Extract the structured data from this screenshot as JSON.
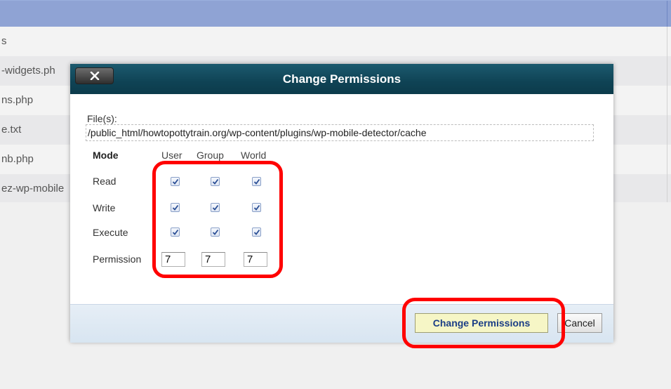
{
  "background": {
    "files": [
      "s",
      "-widgets.ph",
      "ns.php",
      "e.txt",
      "nb.php",
      "ez-wp-mobile"
    ]
  },
  "dialog": {
    "title": "Change Permissions",
    "close_icon": "close-icon",
    "files_label": "File(s):",
    "path": "/public_html/howtopottytrain.org/wp-content/plugins/wp-mobile-detector/cache",
    "columns": [
      "Mode",
      "User",
      "Group",
      "World"
    ],
    "rows": [
      {
        "label": "Read",
        "user": true,
        "group": true,
        "world": true
      },
      {
        "label": "Write",
        "user": true,
        "group": true,
        "world": true
      },
      {
        "label": "Execute",
        "user": true,
        "group": true,
        "world": true
      }
    ],
    "permission_label": "Permission",
    "permission_values": {
      "user": "7",
      "group": "7",
      "world": "7"
    },
    "buttons": {
      "change": "Change Permissions",
      "cancel": "Cancel"
    }
  },
  "colors": {
    "titlebar": "#0f4355",
    "header_band": "#8fa3d4",
    "highlight": "#ff0000",
    "primary_button": "#f6f6c6"
  }
}
